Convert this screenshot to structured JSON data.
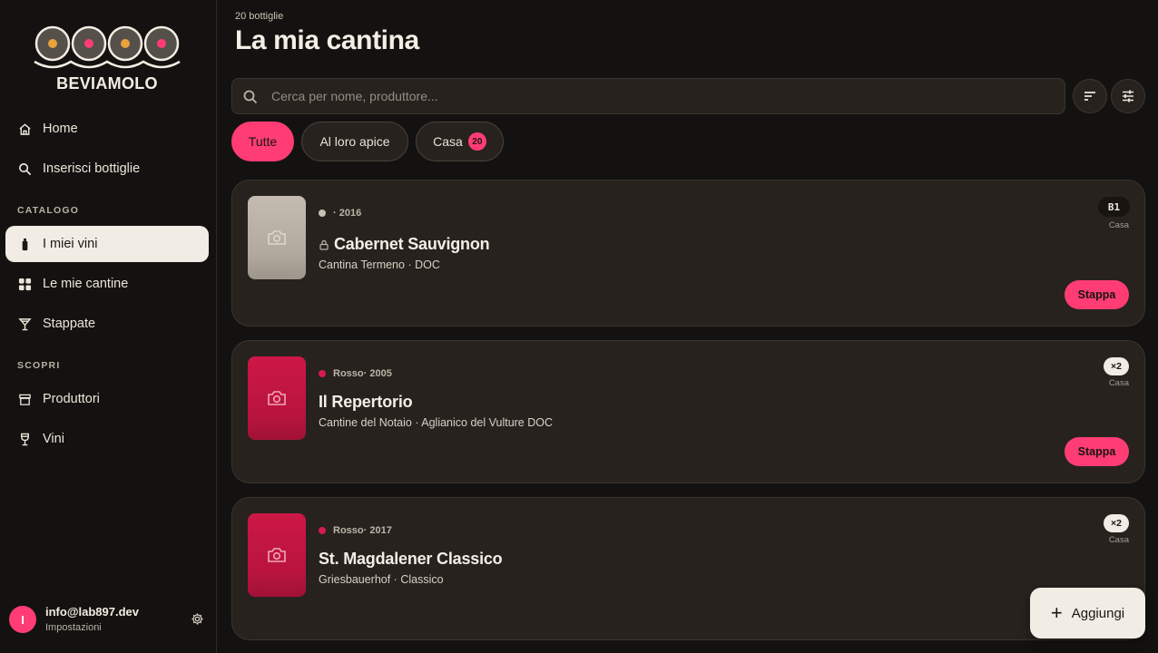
{
  "brand": {
    "name": "BEVIAMOLO",
    "colors": {
      "accent": "#ff3d74",
      "gold": "#e8a33a",
      "bg": "#141210",
      "card": "#27221e"
    }
  },
  "nav": {
    "home": "Home",
    "insert": "Inserisci bottiglie",
    "catalog_label": "CATALOGO",
    "my_wines": "I miei vini",
    "my_cellars": "Le mie cantine",
    "opened": "Stappate",
    "discover_label": "SCOPRI",
    "producers": "Produttori",
    "wines": "Vini"
  },
  "user": {
    "initial": "I",
    "email": "info@lab897.dev",
    "settings": "Impostazioni"
  },
  "header": {
    "count": "20 bottiglie",
    "title": "La mia cantina"
  },
  "search": {
    "placeholder": "Cerca per nome, produttore...",
    "value": ""
  },
  "filters": [
    {
      "label": "Tutte",
      "active": true
    },
    {
      "label": "Al loro apice",
      "active": false
    },
    {
      "label": "Casa",
      "badge": "20",
      "active": false
    }
  ],
  "bottles": [
    {
      "type": "",
      "year": "· 2016",
      "type_color": "#c8c0b3",
      "name": "Cabernet Sauvignon",
      "locked": true,
      "producer": "Cantina Termeno · DOC",
      "slot": "B1",
      "location": "Casa",
      "action": "Stappa"
    },
    {
      "type": "Rosso",
      "year": " · 2005",
      "type_color": "#d41c4c",
      "name": "Il Repertorio",
      "locked": false,
      "producer": "Cantine del Notaio · Aglianico del Vulture DOC",
      "slot": "×2",
      "location": "Casa",
      "action": "Stappa"
    },
    {
      "type": "Rosso",
      "year": " · 2017",
      "type_color": "#d41c4c",
      "name": "St. Magdalener Classico",
      "locked": false,
      "producer": "Griesbauerhof · Classico",
      "slot": "×2",
      "location": "Casa"
    }
  ],
  "fab": {
    "label": "Aggiungi"
  }
}
